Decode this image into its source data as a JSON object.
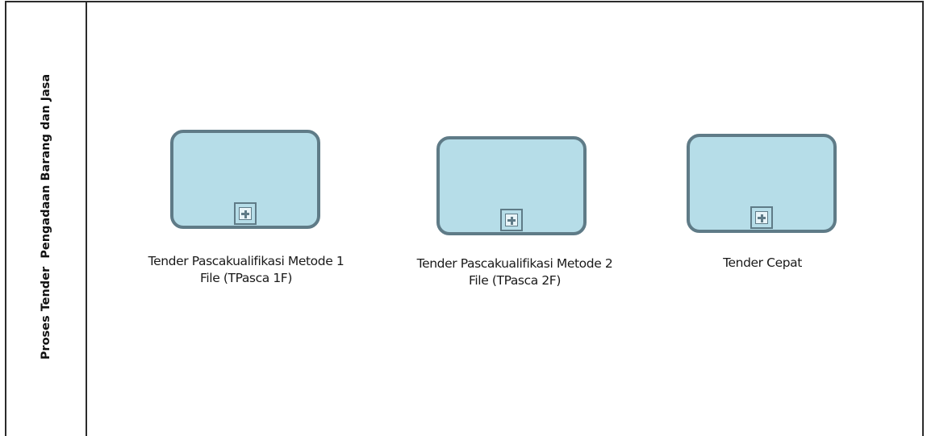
{
  "lane": {
    "title": "Proses Tender  Pengadaan Barang dan Jasa"
  },
  "tasks": [
    {
      "line1": "Tender Pascakualifikasi Metode 1",
      "line2": "File (TPasca 1F)"
    },
    {
      "line1": "Tender Pascakualifikasi Metode 2",
      "line2": "File (TPasca 2F)"
    },
    {
      "line1": "Tender Cepat",
      "line2": ""
    }
  ],
  "colors": {
    "task_fill": "#b6dde8",
    "task_border": "#5f7b87",
    "pool_border": "#2b2b2b"
  },
  "icons": {
    "subprocess_marker": "collapsed-subprocess-plus-icon"
  }
}
